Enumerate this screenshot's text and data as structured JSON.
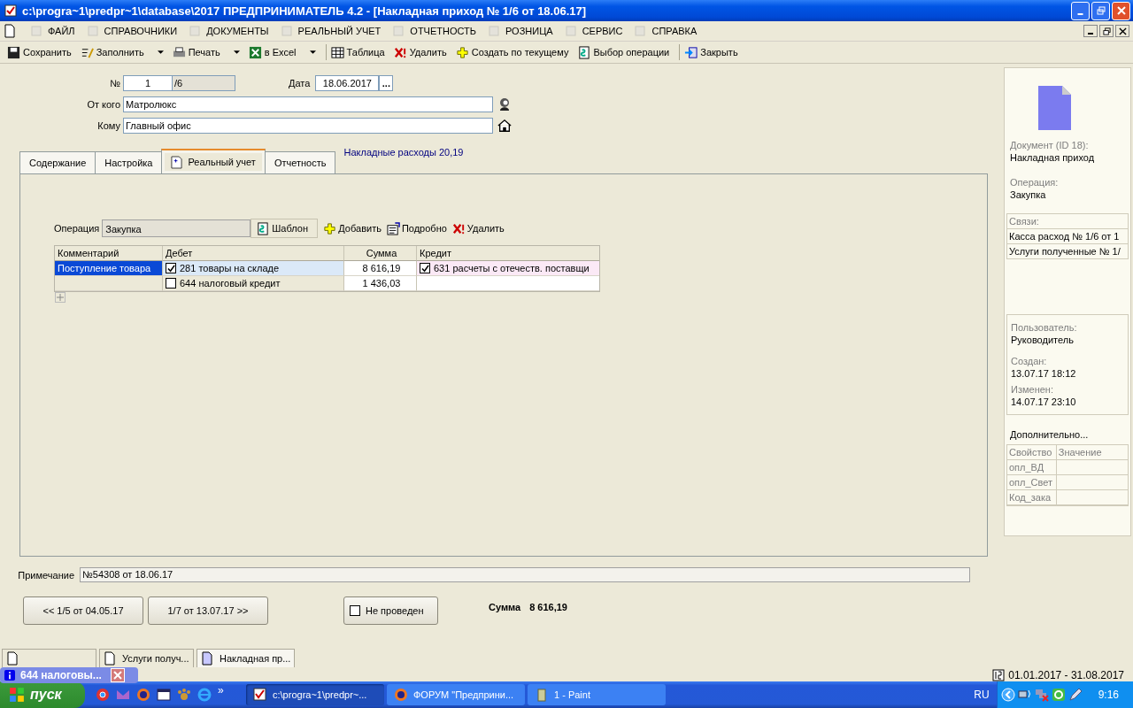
{
  "window": {
    "title": "c:\\progra~1\\predpr~1\\database\\2017  ПРЕДПРИНИМАТЕЛЬ 4.2 - [Накладная приход № 1/6 от 18.06.17]"
  },
  "menu": [
    {
      "label": "ФАЙЛ"
    },
    {
      "label": "СПРАВОЧНИКИ"
    },
    {
      "label": "ДОКУМЕНТЫ"
    },
    {
      "label": "РЕАЛЬНЫЙ УЧЕТ"
    },
    {
      "label": "ОТЧЕТНОСТЬ"
    },
    {
      "label": "РОЗНИЦА"
    },
    {
      "label": "СЕРВИС"
    },
    {
      "label": "СПРАВКА"
    }
  ],
  "toolbar": [
    {
      "label": "Сохранить",
      "dropdown": false
    },
    {
      "label": "Заполнить",
      "dropdown": true
    },
    {
      "label": "Печать",
      "dropdown": true
    },
    {
      "label": "в Excel",
      "dropdown": true
    },
    {
      "label": "Таблица",
      "dropdown": false
    },
    {
      "label": "Удалить",
      "dropdown": false
    },
    {
      "label": "Создать по текущему",
      "dropdown": false
    },
    {
      "label": "Выбор операции",
      "dropdown": false
    },
    {
      "label": "Закрыть",
      "dropdown": false
    }
  ],
  "form": {
    "number_label": "№",
    "number": "1",
    "number_suffix": "/6",
    "date_label": "Дата",
    "date": "18.06.2017",
    "date_button": "...",
    "from_label": "От кого",
    "from": "Матролюкс",
    "to_label": "Кому",
    "to": "Главный офис"
  },
  "tabs": [
    {
      "label": "Содержание",
      "selected": false
    },
    {
      "label": "Настройка",
      "selected": false
    },
    {
      "label": "Реальный учет",
      "selected": true
    },
    {
      "label": "Отчетность",
      "selected": false
    }
  ],
  "overhead": "Накладные расходы 20,19",
  "operation": {
    "label": "Операция",
    "value": "Закупка",
    "template_button": "Шаблон",
    "actions": [
      "Добавить",
      "Подробно",
      "Удалить"
    ]
  },
  "table": {
    "columns": [
      "Комментарий",
      "Дебет",
      "Сумма",
      "Кредит"
    ],
    "rows": [
      {
        "comment": "Поступление товара",
        "selected": true,
        "debit": {
          "checked": true,
          "text": "281 товары на складе"
        },
        "sum": "8 616,19",
        "credit": {
          "checked": true,
          "text": "631  расчеты с  отечеств. поставщи"
        }
      },
      {
        "selected": false,
        "debit": {
          "checked": false,
          "text": "644 налоговый кредит"
        },
        "sum": "1 436,03"
      }
    ]
  },
  "note": {
    "label": "Примечание",
    "value": "№54308 от 18.06.17"
  },
  "nav": {
    "prev": "<< 1/5 от 04.05.17",
    "next": "1/7 от 13.07.17 >>",
    "posted_label": "Не проведен",
    "posted": false,
    "sum_label": "Сумма",
    "sum": "8 616,19"
  },
  "side": {
    "doc_label": "Документ  (ID 18):",
    "doc": "Накладная приход",
    "op_label": "Операция:",
    "op": "Закупка",
    "links_header": "Связи:",
    "links": [
      "Касса расход № 1/6 от 1",
      "Услуги полученные № 1/"
    ],
    "user_label": "Пользователь:",
    "user": "Руководитель",
    "created_label": "Создан:",
    "created": "13.07.17  18:12",
    "changed_label": "Изменен:",
    "changed": "14.07.17  23:10",
    "extra": "Дополнительно...",
    "props_columns": [
      "Свойство",
      "Значение"
    ],
    "props": [
      "опл_ВД",
      "опл_Свет",
      "Код_зака"
    ]
  },
  "doc_tabs": [
    {
      "selected": false
    },
    {
      "label": "Услуги получ...",
      "selected": false
    },
    {
      "label": "Накладная пр...",
      "selected": true
    }
  ],
  "popup": "644 налоговы...",
  "period": "01.01.2017 - 31.08.2017",
  "taskbar": {
    "start": "пуск",
    "more": "»",
    "tasks": [
      {
        "label": "c:\\progra~1\\predpr~...",
        "selected": true
      },
      {
        "label": "ФОРУМ \"Предприни...",
        "selected": false
      },
      {
        "label": "1 - Paint",
        "selected": false
      }
    ],
    "lang": "RU",
    "clock": "9:16"
  }
}
